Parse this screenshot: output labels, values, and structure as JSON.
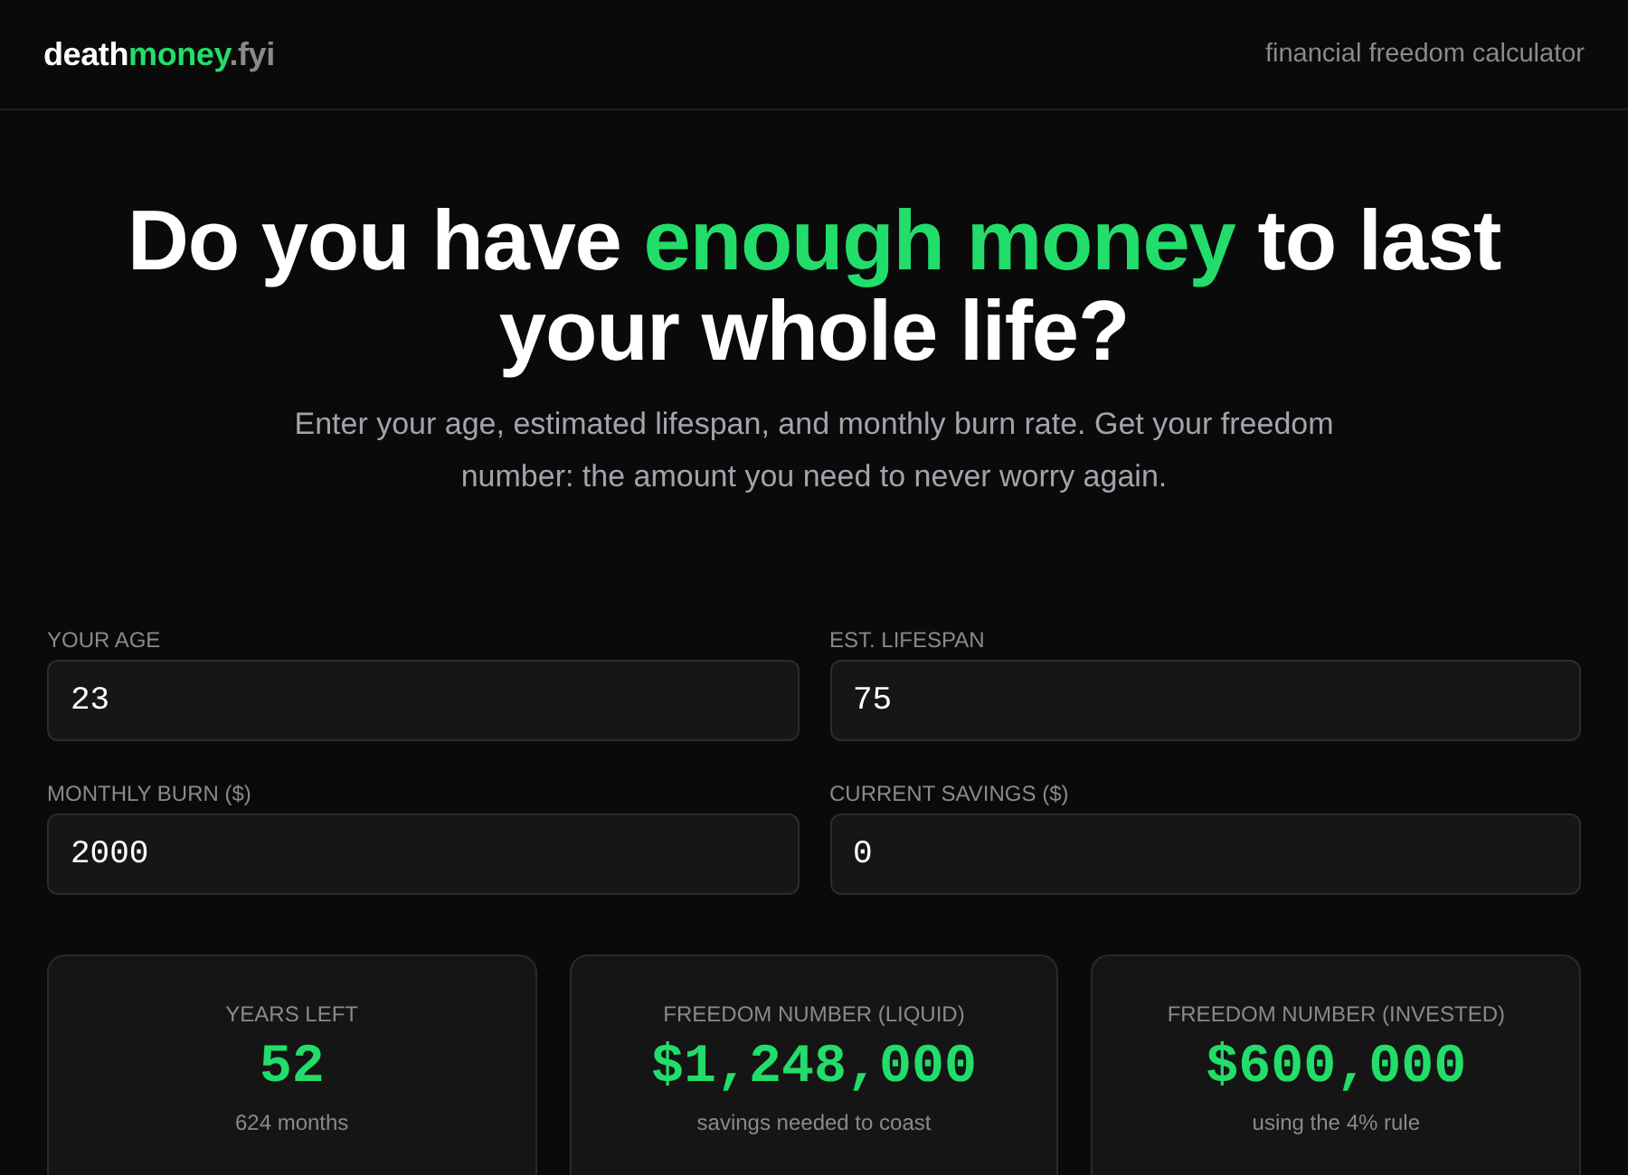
{
  "header": {
    "logo": [
      {
        "text": "death",
        "color": "#ffffff"
      },
      {
        "text": "money",
        "color": "#22dd6a"
      },
      {
        "text": ".fyi",
        "color": "#8a8a8a"
      }
    ],
    "tagline": "financial freedom calculator"
  },
  "hero": {
    "headline": [
      {
        "text": "Do you have ",
        "highlight": false
      },
      {
        "text": "enough money",
        "highlight": true
      },
      {
        "text": " to last your whole life?",
        "highlight": false
      }
    ],
    "subtitle": "Enter your age, estimated lifespan, and monthly burn rate. Get your freedom number: the amount you need to never worry again."
  },
  "fields": [
    {
      "label": "YOUR AGE",
      "value": "23"
    },
    {
      "label": "EST. LIFESPAN",
      "value": "75"
    },
    {
      "label": "MONTHLY BURN ($)",
      "value": "2000"
    },
    {
      "label": "CURRENT SAVINGS ($)",
      "value": "0"
    }
  ],
  "results": [
    {
      "label": "YEARS LEFT",
      "value": "52",
      "note": "624 months"
    },
    {
      "label": "FREEDOM NUMBER (LIQUID)",
      "value": "$1,248,000",
      "note": "savings needed to coast"
    },
    {
      "label": "FREEDOM NUMBER (INVESTED)",
      "value": "$600,000",
      "note": "using the 4% rule"
    }
  ]
}
